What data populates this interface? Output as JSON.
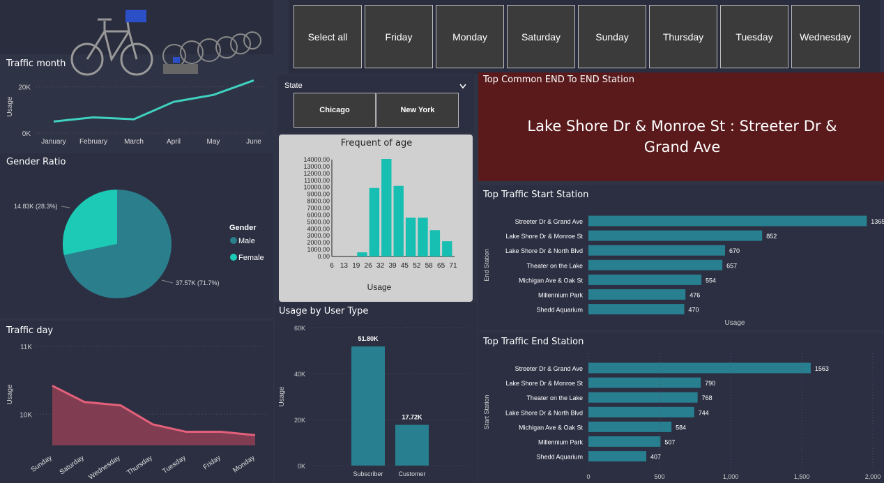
{
  "day_slicer": {
    "buttons": [
      "Select all",
      "Friday",
      "Monday",
      "Saturday",
      "Sunday",
      "Thursday",
      "Tuesday",
      "Wednesday"
    ]
  },
  "state_slicer": {
    "label": "State",
    "options": [
      "Chicago",
      "New York"
    ]
  },
  "traffic_month": {
    "title": "Traffic month",
    "chart_data": {
      "type": "line",
      "x": [
        "January",
        "February",
        "March",
        "April",
        "May",
        "June"
      ],
      "values": [
        5000,
        6800,
        6000,
        13500,
        16500,
        22800
      ],
      "ylabel": "Usage",
      "yticks": [
        "20K",
        "0K"
      ],
      "ylim": [
        0,
        25000
      ],
      "color": "#3fd2c0"
    }
  },
  "gender_ratio": {
    "title": "Gender Ratio",
    "legend_title": "Gender",
    "chart_data": {
      "type": "pie",
      "slices": [
        {
          "name": "Male",
          "value": 37570,
          "label": "37.57K (71.7%)",
          "color": "#2b7e8c"
        },
        {
          "name": "Female",
          "value": 14830,
          "label": "14.83K (28.3%)",
          "color": "#1ccab6"
        }
      ]
    }
  },
  "traffic_day": {
    "title": "Traffic day",
    "chart_data": {
      "type": "area",
      "x": [
        "Sunday",
        "Saturday",
        "Wednesday",
        "Thursday",
        "Tuesday",
        "Friday",
        "Monday"
      ],
      "values": [
        10420,
        10180,
        10130,
        9850,
        9740,
        9740,
        9690
      ],
      "ylabel": "Usage",
      "yticks": [
        "11K",
        "10K"
      ],
      "ylim": [
        9540,
        11000
      ],
      "color": "#e3607a"
    }
  },
  "age_freq": {
    "title": "Frequent of age",
    "xlabel": "Usage",
    "chart_data": {
      "type": "bar",
      "categories": [
        "6",
        "13",
        "19",
        "26",
        "32",
        "39",
        "45",
        "52",
        "58",
        "65",
        "71"
      ],
      "values": [
        0,
        0,
        600,
        9900,
        14100,
        10200,
        5600,
        5600,
        3800,
        2200
      ],
      "yticks": [
        "14000.00",
        "13000.00",
        "12000.00",
        "11000.00",
        "10000.00",
        "9000.00",
        "8000.00",
        "7000.00",
        "6000.00",
        "5000.00",
        "4000.00",
        "3000.00",
        "2000.00",
        "1000.00",
        "0.00"
      ],
      "ylim": [
        0,
        14000
      ],
      "color": "#17bfb2"
    }
  },
  "user_type": {
    "title": "Usage by User Type",
    "chart_data": {
      "type": "bar",
      "categories": [
        "Subscriber",
        "Customer"
      ],
      "values": [
        51800,
        17720
      ],
      "value_labels": [
        "51.80K",
        "17.72K"
      ],
      "ylabel": "Usage",
      "yticks": [
        "60K",
        "40K",
        "20K",
        "0K"
      ],
      "ylim": [
        0,
        60000
      ],
      "color": "#277f8f"
    }
  },
  "top_common": {
    "title": "Top Common END To END Station",
    "value": "Lake Shore Dr & Monroe St : Streeter Dr & Grand Ave",
    "color": "#5a1a1c"
  },
  "start_station": {
    "title": "Top Traffic Start Station",
    "chart_data": {
      "type": "bar",
      "orientation": "horizontal",
      "categories": [
        "Streeter Dr & Grand Ave",
        "Lake Shore Dr & Monroe St",
        "Lake Shore Dr & North Blvd",
        "Theater on the Lake",
        "Michigan Ave & Oak St",
        "Millennium Park",
        "Shedd Aquarium"
      ],
      "values": [
        1365,
        852,
        670,
        657,
        554,
        476,
        470
      ],
      "ylabel": "End Station",
      "xlabel": "Usage",
      "xlim": [
        0,
        1400
      ],
      "color": "#277f8f"
    }
  },
  "end_station": {
    "title": "Top Traffic End Station",
    "chart_data": {
      "type": "bar",
      "orientation": "horizontal",
      "categories": [
        "Streeter Dr & Grand Ave",
        "Lake Shore Dr & Monroe St",
        "Theater on the Lake",
        "Lake Shore Dr & North Blvd",
        "Michigan Ave & Oak St",
        "Millennium Park",
        "Shedd Aquarium"
      ],
      "values": [
        1563,
        790,
        768,
        744,
        584,
        507,
        407
      ],
      "ylabel": "Start Station",
      "xticks": [
        "0",
        "500",
        "1,000",
        "1,500",
        "2,000"
      ],
      "xlim": [
        0,
        2000
      ],
      "color": "#277f8f"
    }
  }
}
